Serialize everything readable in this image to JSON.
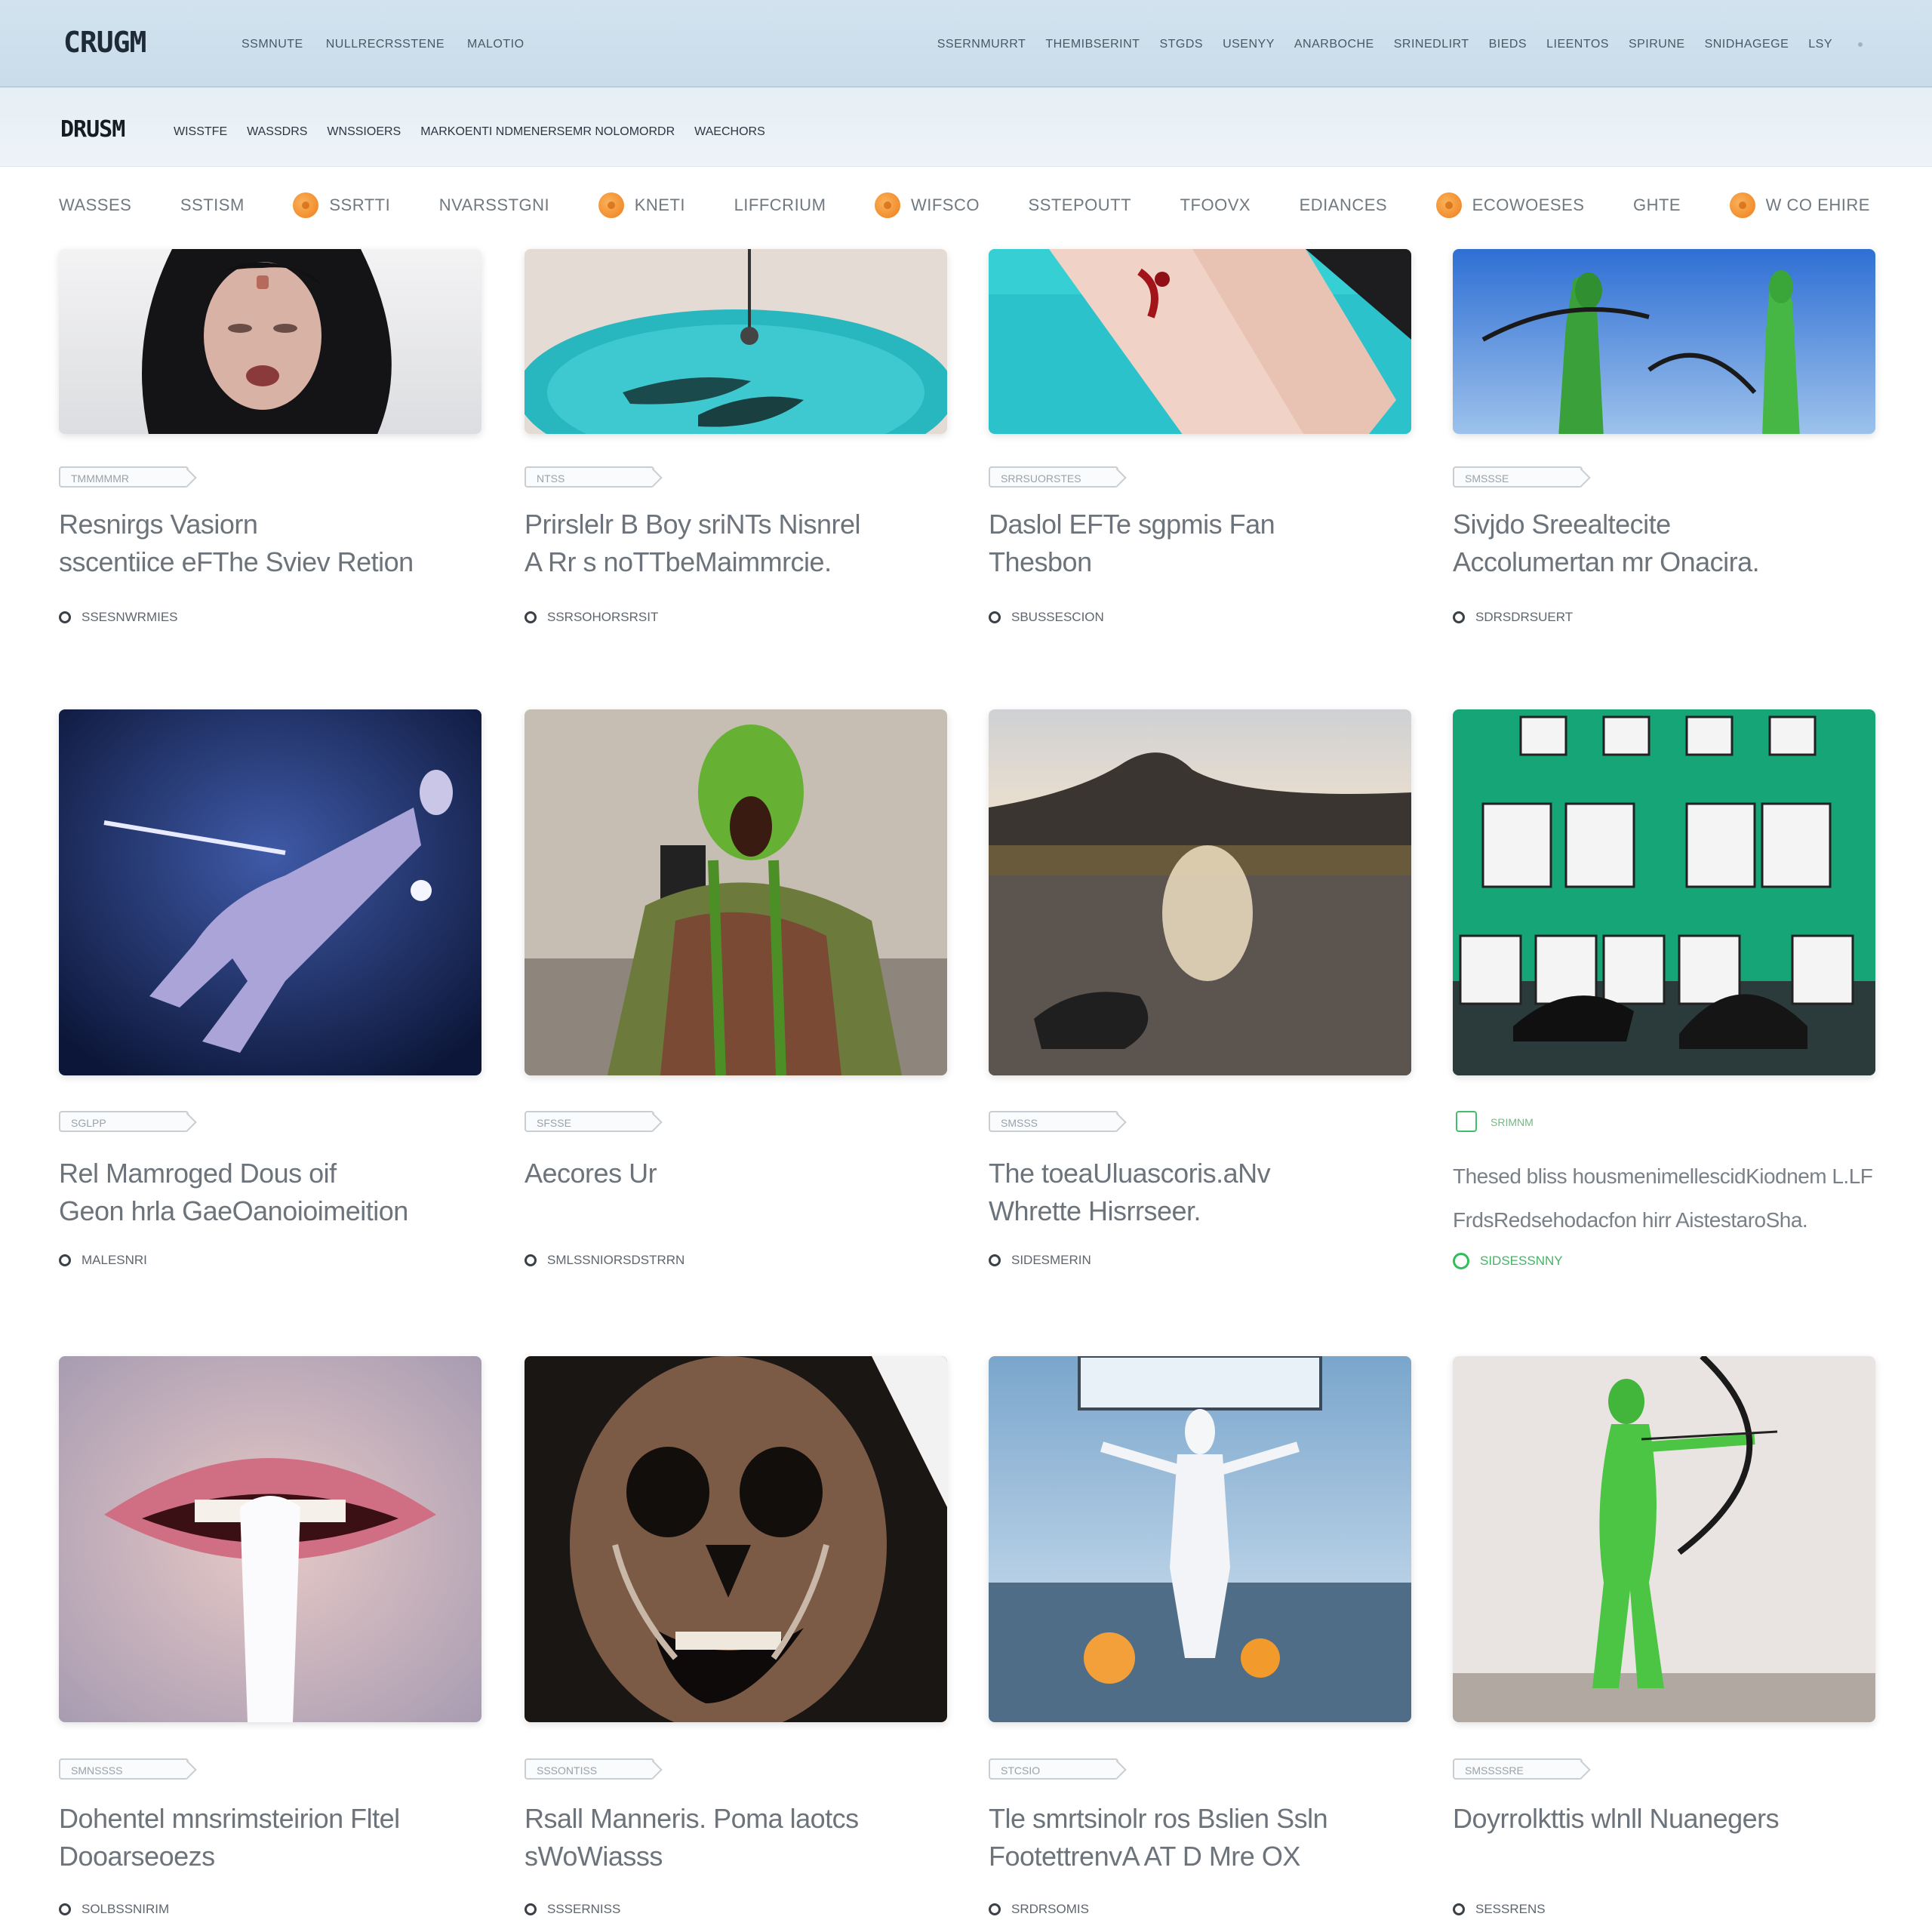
{
  "header": {
    "logo": "CRUGM",
    "nav_left": [
      "SSMNUTE",
      "NULLRECRSSTENE",
      "MALOTIO"
    ],
    "nav_right": [
      "SSERNMURRT",
      "THEMIBSERINT",
      "STGDS",
      "USENYY",
      "ANARBOCHE",
      "SRINEDLIRT",
      "BIEDS",
      "LIEENTOS",
      "SPIRUNE",
      "SNIDHAGEGE",
      "LSY"
    ]
  },
  "subheader": {
    "logo": "DRUSM",
    "links": [
      "WISSTFE",
      "WASSDRS",
      "WNSSIOERS",
      "MARKOENTI NDMENERSEMR NOLOMORDR",
      "WAECHORS"
    ]
  },
  "categories": [
    {
      "label": "WASSES",
      "dot": false
    },
    {
      "label": "SSTISM",
      "dot": false
    },
    {
      "label": "SSRTTI",
      "dot": true
    },
    {
      "label": "NVARSSTGNI",
      "dot": false
    },
    {
      "label": "KNETI",
      "dot": true
    },
    {
      "label": "LIFFCRIUM",
      "dot": false
    },
    {
      "label": "WIFSCO",
      "dot": true
    },
    {
      "label": "SSTEPOUTT",
      "dot": false
    },
    {
      "label": "TFOOVX",
      "dot": false
    },
    {
      "label": "EDIANCES",
      "dot": false
    },
    {
      "label": "ECOWOESES",
      "dot": true
    },
    {
      "label": "GHTE",
      "dot": false
    },
    {
      "label": "W CO EHIRE",
      "dot": true
    }
  ],
  "cards": [
    {
      "tag": "TMMMMMR",
      "title_1": "Resnirgs Vasiorn",
      "title_2": "sscentiice eFThe Sviev Retion",
      "meta": "SSESNWRMIES",
      "scene": "woman-portrait"
    },
    {
      "tag": "NTSS",
      "title_1": "Prirslelr B Boy sriNTs Nisnrel",
      "title_2": "A Rr s noTTbeMaimmrcie.",
      "meta": "SSRSOHORSRSIT",
      "scene": "pool"
    },
    {
      "tag": "SRRSUORSTES",
      "title_1": "Daslol EFTe sgpmis Fan",
      "title_2": "Thesbon",
      "meta": "SBUSSESCION",
      "scene": "pool-legs"
    },
    {
      "tag": "SMSSSE",
      "title_1": "Sivjdo Sreealtecite",
      "title_2": "Accolumertan mr Onacira.",
      "meta": "SDRSDRSUERT",
      "scene": "green-figures"
    },
    {
      "tag": "SGLPP",
      "title_1": "Rel Mamroged Dous oif",
      "title_2": "Geon hrla GaeOanoioimeition",
      "meta": "MALESNRI",
      "scene": "floating-figure"
    },
    {
      "tag": "SFSSE",
      "title_1": "Aecores Ur",
      "title_2": "",
      "meta": "SMLSSNIORSDSTRRN",
      "scene": "green-face"
    },
    {
      "tag": "SMSSS",
      "title_1": "The toeaUluascoris.aNv",
      "title_2": "Whrette Hisrrseer.",
      "meta": "SIDESMERIN",
      "scene": "sunset"
    },
    {
      "tag": "SRIMNM",
      "title_1": "Thesed bliss housmenimellescidKiodnem L.LF",
      "title_2": "FrdsRedsehodacfon hirr AistestaroSha.",
      "meta": "SIDSESSNNY",
      "scene": "gallery"
    },
    {
      "tag": "SMNSSSS",
      "title_1": "Dohentel mnsrimsteirion Fltel",
      "title_2": "Dooarseoezs",
      "meta": "SOLBSSNIRIM",
      "scene": "mouth"
    },
    {
      "tag": "SSSONTISS",
      "title_1": "Rsall Manneris. Poma laotcs",
      "title_2": "sWoWiasss",
      "meta": "SSSERNISS",
      "scene": "skull-face"
    },
    {
      "tag": "STCSIO",
      "title_1": "Tle smrtsinolr ros Bslien Ssln",
      "title_2": "FootettrenvA AT D Mre OX",
      "meta": "SRDRSOMIS",
      "scene": "white-figure"
    },
    {
      "tag": "SMSSSSRE",
      "title_1": "Doyrrolkttis wlnll Nuanegers",
      "title_2": "",
      "meta": "SESSRENS",
      "scene": "archer"
    }
  ],
  "colors": {
    "header_bg": "#cfe1ee",
    "subheader_bg": "#e9f1f7",
    "accent_orange": "#f28a26",
    "accent_green": "#2fbf5a"
  }
}
